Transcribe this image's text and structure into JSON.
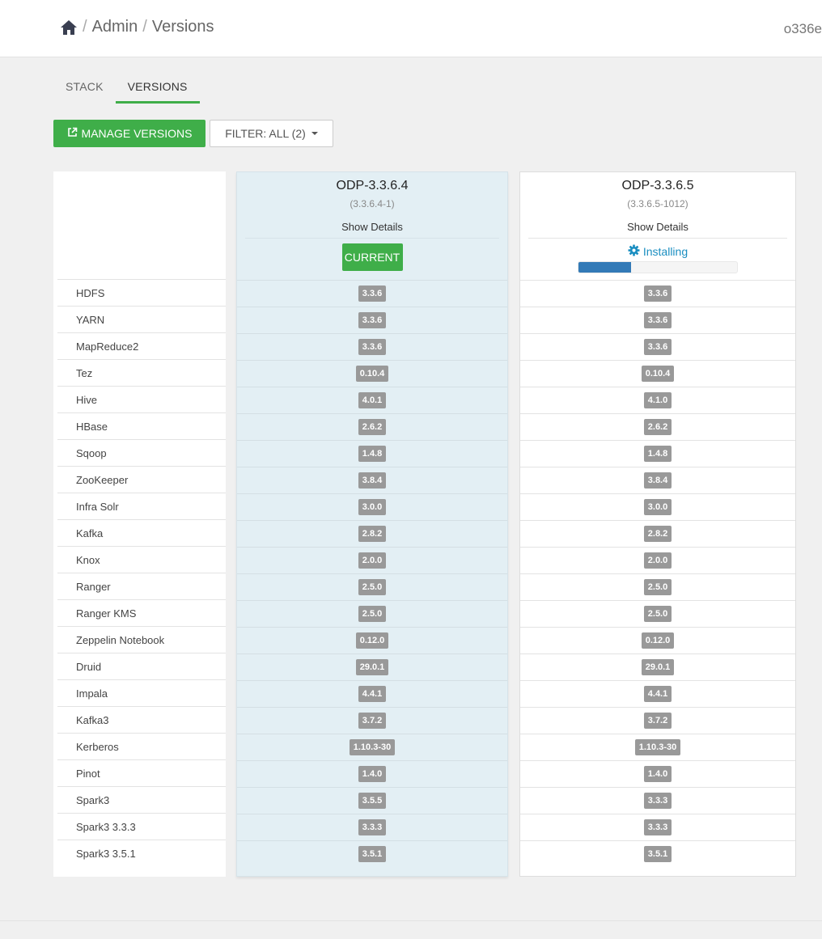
{
  "breadcrumb": {
    "admin": "Admin",
    "versions": "Versions",
    "separator": "/"
  },
  "cluster_name": "o336e",
  "tabs": [
    {
      "label": "STACK",
      "active": false
    },
    {
      "label": "VERSIONS",
      "active": true
    }
  ],
  "toolbar": {
    "manage_label": "MANAGE VERSIONS",
    "filter_label": "FILTER: ALL (2)"
  },
  "colors": {
    "accent_green": "#3fae49",
    "progress_blue": "#337ab7",
    "link_blue": "#1a8ec1",
    "badge_gray": "#999999"
  },
  "services": [
    "HDFS",
    "YARN",
    "MapReduce2",
    "Tez",
    "Hive",
    "HBase",
    "Sqoop",
    "ZooKeeper",
    "Infra Solr",
    "Kafka",
    "Knox",
    "Ranger",
    "Ranger KMS",
    "Zeppelin Notebook",
    "Druid",
    "Impala",
    "Kafka3",
    "Kerberos",
    "Pinot",
    "Spark3",
    "Spark3 3.3.3",
    "Spark3 3.5.1"
  ],
  "versions": [
    {
      "name": "ODP-3.3.6.4",
      "build": "(3.3.6.4-1)",
      "details_label": "Show Details",
      "status_label": "CURRENT",
      "service_versions": [
        "3.3.6",
        "3.3.6",
        "3.3.6",
        "0.10.4",
        "4.0.1",
        "2.6.2",
        "1.4.8",
        "3.8.4",
        "3.0.0",
        "2.8.2",
        "2.0.0",
        "2.5.0",
        "2.5.0",
        "0.12.0",
        "29.0.1",
        "4.4.1",
        "3.7.2",
        "1.10.3-30",
        "1.4.0",
        "3.5.5",
        "3.3.3",
        "3.5.1"
      ]
    },
    {
      "name": "ODP-3.3.6.5",
      "build": "(3.3.6.5-1012)",
      "details_label": "Show Details",
      "status_label": "Installing",
      "progress": 0.33,
      "service_versions": [
        "3.3.6",
        "3.3.6",
        "3.3.6",
        "0.10.4",
        "4.1.0",
        "2.6.2",
        "1.4.8",
        "3.8.4",
        "3.0.0",
        "2.8.2",
        "2.0.0",
        "2.5.0",
        "2.5.0",
        "0.12.0",
        "29.0.1",
        "4.4.1",
        "3.7.2",
        "1.10.3-30",
        "1.4.0",
        "3.3.3",
        "3.3.3",
        "3.5.1"
      ]
    }
  ],
  "icons": {
    "home": "home-icon",
    "external_link": "external-link-icon",
    "gear": "gear-icon",
    "caret": "caret-down-icon"
  }
}
